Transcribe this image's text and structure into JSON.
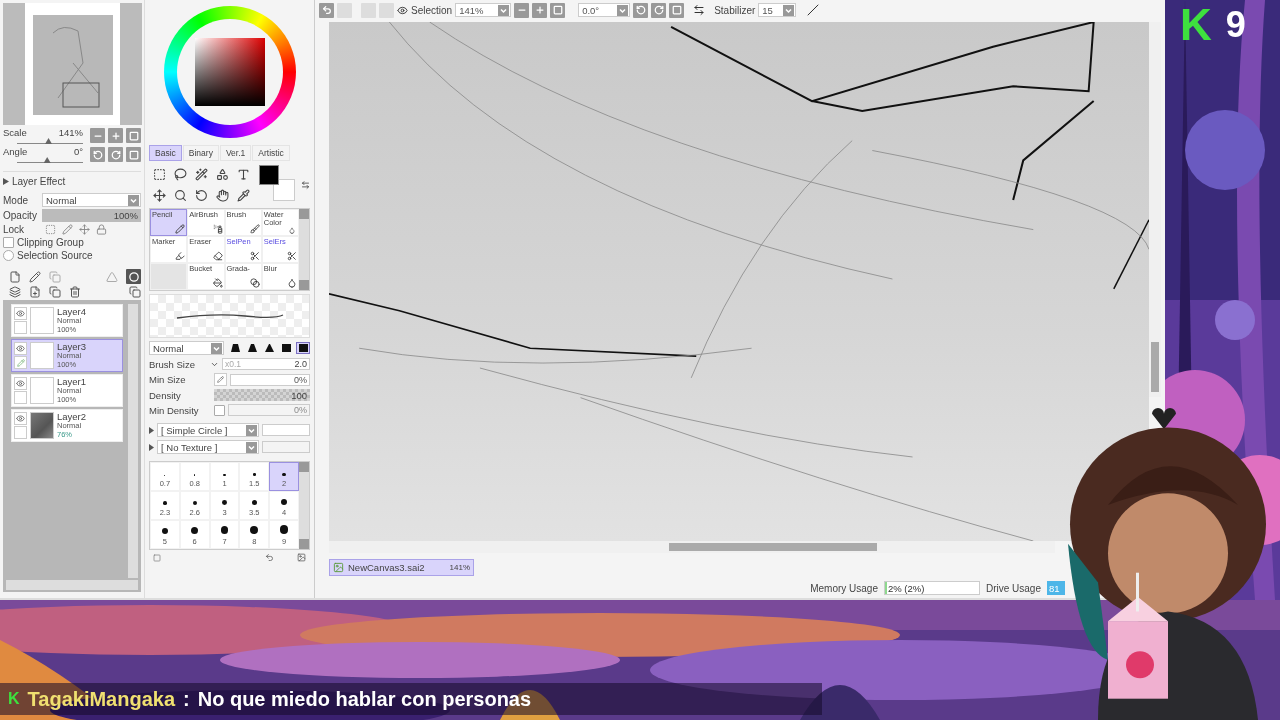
{
  "navigator": {
    "scale": {
      "label": "Scale",
      "value": "141%",
      "level": 0.47
    },
    "angle": {
      "label": "Angle",
      "value": "0°",
      "level": 0.45
    }
  },
  "layer_effect": {
    "title": "Layer Effect",
    "expanded": false,
    "mode_label": "Mode",
    "mode": "Normal",
    "opacity_label": "Opacity",
    "opacity": {
      "value": "100%",
      "level": 1
    },
    "lock_label": "Lock",
    "clipping_group": {
      "label": "Clipping Group",
      "checked": false
    },
    "selection_source": {
      "label": "Selection Source",
      "selected": false
    }
  },
  "layers": [
    {
      "name": "Layer4",
      "mode": "Normal",
      "opacity": "100%",
      "selected": false,
      "kind": "blank",
      "reduced_opacity": false
    },
    {
      "name": "Layer3",
      "mode": "Normal",
      "opacity": "100%",
      "selected": true,
      "kind": "blank",
      "reduced_opacity": false
    },
    {
      "name": "Layer1",
      "mode": "Normal",
      "opacity": "100%",
      "selected": false,
      "kind": "blank",
      "reduced_opacity": false
    },
    {
      "name": "Layer2",
      "mode": "Normal",
      "opacity": "76%",
      "selected": false,
      "kind": "sketch",
      "reduced_opacity": true
    }
  ],
  "color_tabs": [
    {
      "label": "Basic",
      "selected": true
    },
    {
      "label": "Binary",
      "selected": false
    },
    {
      "label": "Ver.1",
      "selected": false
    },
    {
      "label": "Artistic",
      "selected": false
    }
  ],
  "brush_tools": [
    {
      "label": "Pencil",
      "selected": true,
      "kind": "paint"
    },
    {
      "label": "AirBrush",
      "selected": false,
      "kind": "paint"
    },
    {
      "label": "Brush",
      "selected": false,
      "kind": "paint"
    },
    {
      "label": "Water Color",
      "selected": false,
      "kind": "paint"
    },
    {
      "label": "Marker",
      "selected": false,
      "kind": "paint"
    },
    {
      "label": "Eraser",
      "selected": false,
      "kind": "paint"
    },
    {
      "label": "SelPen",
      "selected": false,
      "kind": "selection"
    },
    {
      "label": "SelErs",
      "selected": false,
      "kind": "selection"
    },
    {
      "kind": "empty"
    },
    {
      "label": "Bucket",
      "selected": false,
      "kind": "paint"
    },
    {
      "label": "Grada-",
      "selected": false,
      "kind": "paint"
    },
    {
      "label": "Blur",
      "selected": false,
      "kind": "paint"
    }
  ],
  "brush_mode": "Normal",
  "brush_tips": [
    {
      "selected": false
    },
    {
      "selected": false
    },
    {
      "selected": false
    },
    {
      "selected": false
    },
    {
      "selected": true
    }
  ],
  "brush_settings": [
    {
      "kind": "size",
      "label": "Brush Size",
      "multiplier": "x0.1",
      "value": "2.0"
    },
    {
      "kind": "field",
      "label": "Min Size",
      "value": "0%"
    },
    {
      "kind": "bar",
      "label": "Density",
      "value": "100",
      "level": 1
    },
    {
      "kind": "toggle",
      "label": "Min Density",
      "value": "0%",
      "checked": false
    }
  ],
  "brush_shape": "[ Simple Circle ]",
  "brush_texture": "[ No Texture ]",
  "brush_sizes": [
    {
      "label": "0.7",
      "selected": false
    },
    {
      "label": "0.8",
      "selected": false
    },
    {
      "label": "1",
      "selected": false
    },
    {
      "label": "1.5",
      "selected": false
    },
    {
      "label": "2",
      "selected": true
    },
    {
      "label": "2.3",
      "selected": false
    },
    {
      "label": "2.6",
      "selected": false
    },
    {
      "label": "3",
      "selected": false
    },
    {
      "label": "3.5",
      "selected": false
    },
    {
      "label": "4",
      "selected": false
    },
    {
      "label": "5",
      "selected": false
    },
    {
      "label": "6",
      "selected": false
    },
    {
      "label": "7",
      "selected": false
    },
    {
      "label": "8",
      "selected": false
    },
    {
      "label": "9",
      "selected": false
    }
  ],
  "toolbar": {
    "selection_label": "Selection",
    "zoom": "141%",
    "angle": "0.0°",
    "stabilizer_label": "Stabilizer",
    "stabilizer": "15"
  },
  "canvas_tab": {
    "name": "NewCanvas3.sai2",
    "zoom": "141%"
  },
  "status_bar": {
    "memory_label": "Memory Usage",
    "memory": {
      "value": "2% (2%)",
      "level": 0.02
    },
    "drive_label": "Drive Usage",
    "drive": "81"
  },
  "channel_badge": {
    "logo": "K",
    "count": "9"
  },
  "chat": {
    "badge": "K",
    "user": "TagakiMangaka",
    "separator": ":",
    "message": "No que miedo hablar con personas"
  }
}
